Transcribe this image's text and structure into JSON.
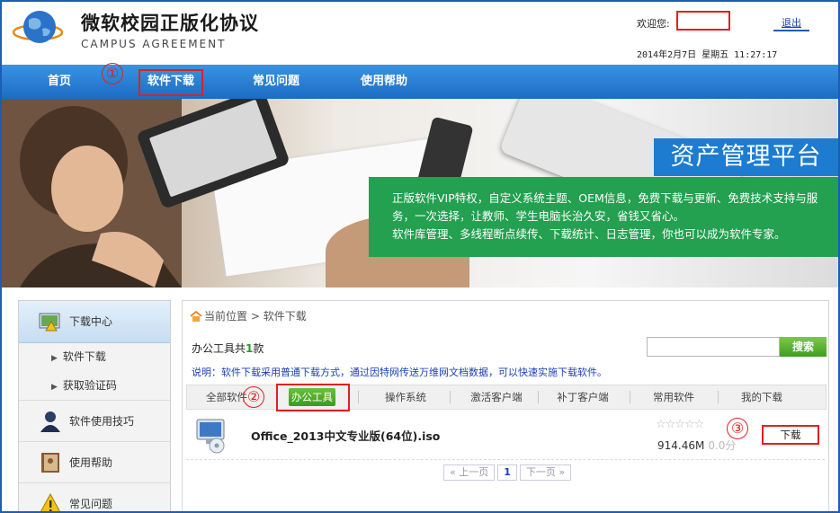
{
  "header": {
    "title": "微软校园正版化协议",
    "subtitle": "CAMPUS AGREEMENT",
    "welcome_label": "欢迎您:",
    "logout_label": "退出",
    "datetime": "2014年2月7日 星期五 11:27:17"
  },
  "nav": {
    "items": [
      {
        "label": "首页"
      },
      {
        "label": "软件下载"
      },
      {
        "label": "常见问题"
      },
      {
        "label": "使用帮助"
      }
    ]
  },
  "annotations": [
    "①",
    "②",
    "③"
  ],
  "banner": {
    "title": "资产管理平台",
    "lines": [
      "正版软件VIP特权，自定义系统主题、OEM信息，免费下载与更新、免费技术支持与服",
      "务，一次选择，让教师、学生电脑长治久安，省钱又省心。",
      "软件库管理、多线程断点续传、下载统计、日志管理，你也可以成为软件专家。"
    ]
  },
  "sidebar": {
    "download_center": "下载中心",
    "sub_items": [
      {
        "label": "软件下载"
      },
      {
        "label": "获取验证码"
      }
    ],
    "entries": [
      {
        "label": "软件使用技巧",
        "icon": "user-icon"
      },
      {
        "label": "使用帮助",
        "icon": "book-icon"
      },
      {
        "label": "常见问题",
        "icon": "warning-icon"
      }
    ]
  },
  "main": {
    "breadcrumb_prefix": "当前位置",
    "breadcrumb_sep": ">",
    "breadcrumb_page": "软件下载",
    "count_prefix": "办公工具共",
    "count": "1",
    "count_suffix": "款",
    "search_button": "搜索",
    "search_value": "",
    "note": "说明：软件下载采用普通下载方式，通过因特网传送万维网文档数据，可以快速实施下载软件。",
    "tabs": [
      {
        "label": "全部软件"
      },
      {
        "label": "办公工具"
      },
      {
        "label": "操作系统"
      },
      {
        "label": "激活客户端"
      },
      {
        "label": "补丁客户端"
      },
      {
        "label": "常用软件"
      },
      {
        "label": "我的下载"
      }
    ],
    "file": {
      "name": "Office_2013中文专业版(64位).iso",
      "size": "914.46M",
      "score": "0.0分",
      "rating_stars": 0,
      "download_label": "下载"
    },
    "pager": {
      "prev": "« 上一页",
      "current": "1",
      "next": "下一页 »"
    }
  },
  "colors": {
    "nav_blue": "#1b6cc4",
    "banner_title_blue": "#1d7cd0",
    "banner_green": "#23a050",
    "button_green": "#3f9e1f",
    "annotation_red": "#e02020"
  }
}
